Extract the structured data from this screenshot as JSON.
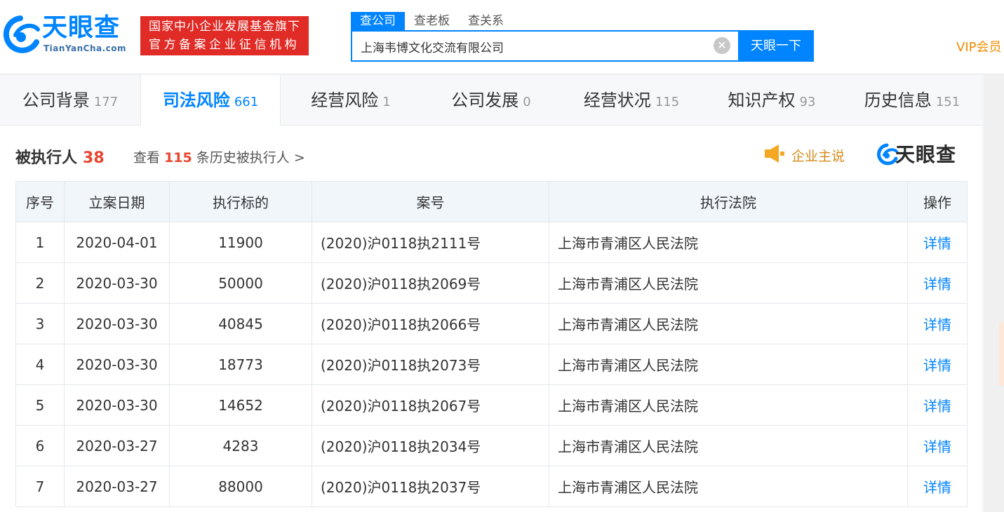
{
  "header": {
    "logo_cn": "天眼查",
    "logo_en": "TianYanCha.com",
    "badge_line1": "国家中小企业发展基金旗下",
    "badge_line2": "官方备案企业征信机构",
    "search_tabs": [
      "查公司",
      "查老板",
      "查关系"
    ],
    "search_value": "上海韦博文化交流有限公司",
    "search_button": "天眼一下",
    "vip": "VIP会员",
    "clear_symbol": "✕"
  },
  "nav_tabs": [
    {
      "label": "公司背景",
      "count": "177"
    },
    {
      "label": "司法风险",
      "count": "661"
    },
    {
      "label": "经营风险",
      "count": "1"
    },
    {
      "label": "公司发展",
      "count": "0"
    },
    {
      "label": "经营状况",
      "count": "115"
    },
    {
      "label": "知识产权",
      "count": "93"
    },
    {
      "label": "历史信息",
      "count": "151"
    }
  ],
  "section": {
    "title": "被执行人",
    "count": "38",
    "history_prefix": "查看",
    "history_count": "115",
    "history_suffix": "条历史被执行人 >",
    "enterprise_say": "企业主说",
    "brand": "天眼查"
  },
  "table": {
    "headers": [
      "序号",
      "立案日期",
      "执行标的",
      "案号",
      "执行法院",
      "操作"
    ],
    "rows": [
      [
        "1",
        "2020-04-01",
        "11900",
        "(2020)沪0118执2111号",
        "上海市青浦区人民法院",
        "详情"
      ],
      [
        "2",
        "2020-03-30",
        "50000",
        "(2020)沪0118执2069号",
        "上海市青浦区人民法院",
        "详情"
      ],
      [
        "3",
        "2020-03-30",
        "40845",
        "(2020)沪0118执2066号",
        "上海市青浦区人民法院",
        "详情"
      ],
      [
        "4",
        "2020-03-30",
        "18773",
        "(2020)沪0118执2073号",
        "上海市青浦区人民法院",
        "详情"
      ],
      [
        "5",
        "2020-03-30",
        "14652",
        "(2020)沪0118执2067号",
        "上海市青浦区人民法院",
        "详情"
      ],
      [
        "6",
        "2020-03-27",
        "4283",
        "(2020)沪0118执2034号",
        "上海市青浦区人民法院",
        "详情"
      ],
      [
        "7",
        "2020-03-27",
        "88000",
        "(2020)沪0118执2037号",
        "上海市青浦区人民法院",
        "详情"
      ]
    ]
  }
}
